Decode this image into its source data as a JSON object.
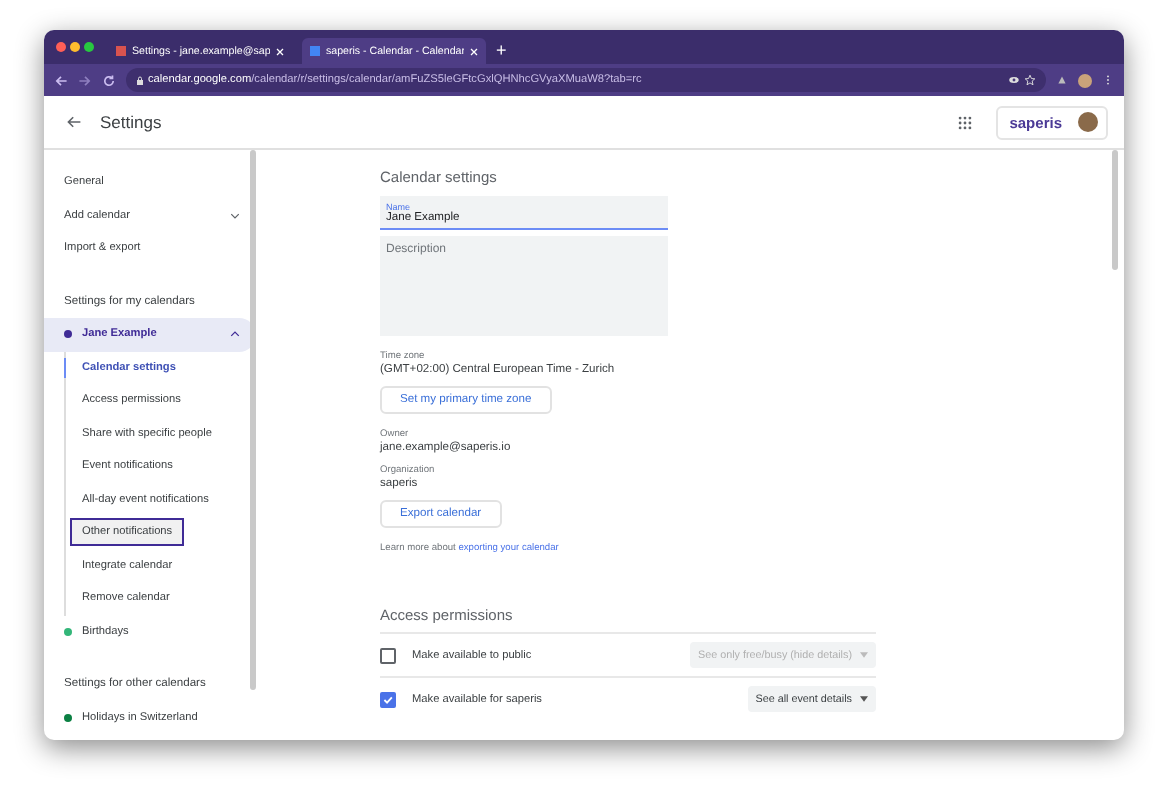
{
  "browser": {
    "tabs": [
      {
        "title": "Settings - jane.example@sap",
        "selected": false
      },
      {
        "title": "saperis - Calendar - Calendar",
        "selected": true
      }
    ],
    "new_tab": "+",
    "address": {
      "host": "calendar.google.com",
      "path": "/calendar/r/settings/calendar/amFuZS5leGFtcGxlQHNhcGVyaXMuaW8?tab=rc"
    }
  },
  "header": {
    "title": "Settings",
    "brand": "saperis"
  },
  "sidebar": {
    "items": [
      {
        "kind": "link",
        "label": "General",
        "expandable": false
      },
      {
        "kind": "link",
        "label": "Add calendar",
        "expandable": true
      },
      {
        "kind": "link",
        "label": "Import & export",
        "expandable": false
      },
      {
        "kind": "heading",
        "label": "Settings for my calendars"
      },
      {
        "kind": "calendar",
        "label": "Jane Example",
        "color": "#3f2b96",
        "expanded": true
      },
      {
        "kind": "sub",
        "label": "Calendar settings",
        "selected": true,
        "focused": false
      },
      {
        "kind": "sub",
        "label": "Access permissions",
        "selected": false,
        "focused": false
      },
      {
        "kind": "sub",
        "label": "Share with specific people",
        "selected": false,
        "focused": false
      },
      {
        "kind": "sub",
        "label": "Event notifications",
        "selected": false,
        "focused": false
      },
      {
        "kind": "sub",
        "label": "All-day event notifications",
        "selected": false,
        "focused": false
      },
      {
        "kind": "sub",
        "label": "Other notifications",
        "selected": false,
        "focused": true
      },
      {
        "kind": "sub",
        "label": "Integrate calendar",
        "selected": false,
        "focused": false
      },
      {
        "kind": "sub",
        "label": "Remove calendar",
        "selected": false,
        "focused": false
      },
      {
        "kind": "calendar",
        "label": "Birthdays",
        "color": "#33b679",
        "expanded": false
      },
      {
        "kind": "heading",
        "label": "Settings for other calendars"
      },
      {
        "kind": "calendar",
        "label": "Holidays in Switzerland",
        "color": "#0b8043",
        "expanded": false
      }
    ]
  },
  "main": {
    "title": "Calendar settings",
    "name_field": {
      "label": "Name",
      "value": "Jane Example"
    },
    "description_field": {
      "placeholder": "Description"
    },
    "time_zone": {
      "label": "Time zone",
      "value": "(GMT+02:00) Central European Time - Zurich",
      "button": "Set my primary time zone"
    },
    "owner": {
      "label": "Owner",
      "value": "jane.example@saperis.io"
    },
    "organization": {
      "label": "Organization",
      "value": "saperis"
    },
    "export_button": "Export calendar",
    "learn_more": {
      "text": "Learn more about",
      "link": "exporting your calendar"
    },
    "access": {
      "title": "Access permissions",
      "rows": [
        {
          "label": "Make available to public",
          "checked": false,
          "dropdown": "See only free/busy (hide details)",
          "disabled": true
        },
        {
          "label": "Make available for saperis",
          "checked": true,
          "dropdown": "See all event details",
          "disabled": false
        }
      ]
    }
  }
}
